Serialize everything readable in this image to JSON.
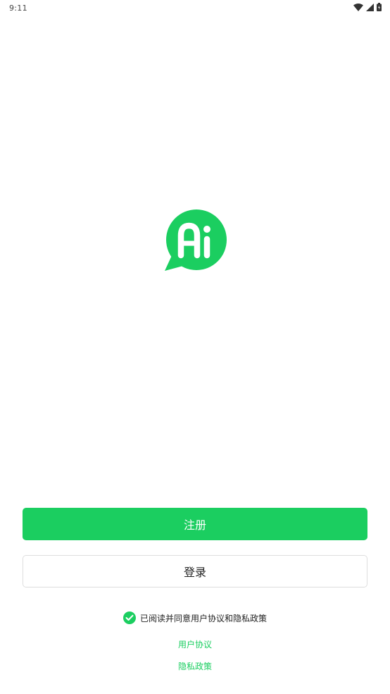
{
  "status_bar": {
    "time": "9:11"
  },
  "logo": {
    "icon": "ai-speech-bubble-logo",
    "text": "Ai",
    "color": "#1bce60"
  },
  "actions": {
    "register_label": "注册",
    "login_label": "登录"
  },
  "agreement": {
    "checked": true,
    "text": "已阅读并同意用户协议和隐私政策",
    "terms_link": "用户协议",
    "privacy_link": "隐私政策"
  },
  "colors": {
    "accent": "#1bce60",
    "button_border": "#dedede"
  }
}
